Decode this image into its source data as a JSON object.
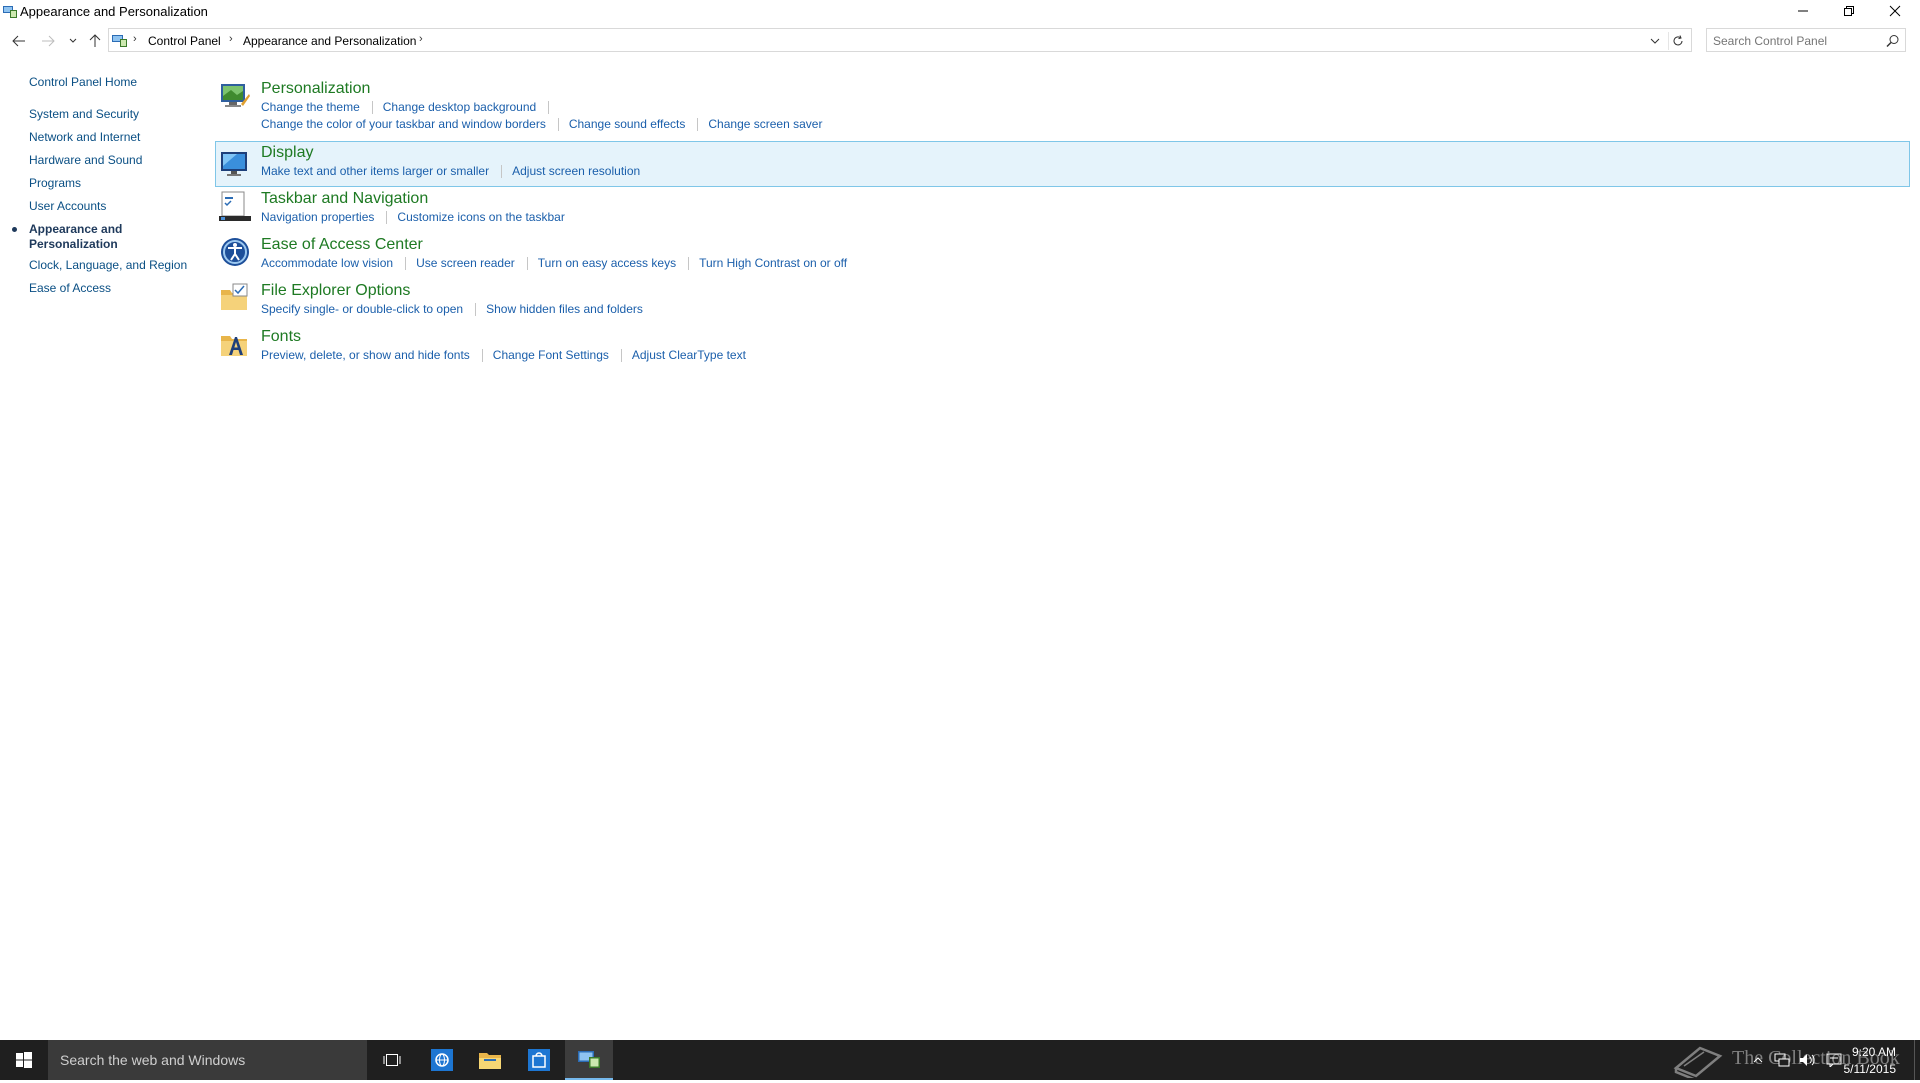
{
  "window": {
    "title": "Appearance and Personalization",
    "controls": [
      "minimize-icon",
      "restore-icon",
      "close-icon"
    ]
  },
  "address_bar": {
    "breadcrumbs": [
      "Control Panel",
      "Appearance and Personalization"
    ],
    "search_placeholder": "Search Control Panel"
  },
  "left_nav": {
    "home": "Control Panel Home",
    "items": [
      {
        "label": "System and Security"
      },
      {
        "label": "Network and Internet"
      },
      {
        "label": "Hardware and Sound"
      },
      {
        "label": "Programs"
      },
      {
        "label": "User Accounts"
      },
      {
        "label": "Appearance and",
        "label2": "Personalization",
        "active": true
      },
      {
        "label": "Clock, Language, and Region"
      },
      {
        "label": "Ease of Access"
      }
    ]
  },
  "categories": [
    {
      "title": "Personalization",
      "icon": "personalization-icon",
      "links_row1": [
        "Change the theme",
        "Change desktop background"
      ],
      "links_row2": [
        "Change the color of your taskbar and window borders",
        "Change sound effects",
        "Change screen saver"
      ]
    },
    {
      "title": "Display",
      "icon": "display-icon",
      "highlighted": true,
      "links_row1": [
        "Make text and other items larger or smaller",
        "Adjust screen resolution"
      ]
    },
    {
      "title": "Taskbar and Navigation",
      "icon": "taskbar-icon",
      "links_row1": [
        "Navigation properties",
        "Customize icons on the taskbar"
      ]
    },
    {
      "title": "Ease of Access Center",
      "icon": "ease-of-access-icon",
      "links_row1": [
        "Accommodate low vision",
        "Use screen reader",
        "Turn on easy access keys",
        "Turn High Contrast on or off"
      ]
    },
    {
      "title": "File Explorer Options",
      "icon": "folder-options-icon",
      "links_row1": [
        "Specify single- or double-click to open",
        "Show hidden files and folders"
      ]
    },
    {
      "title": "Fonts",
      "icon": "fonts-icon",
      "links_row1": [
        "Preview, delete, or show and hide fonts",
        "Change Font Settings",
        "Adjust ClearType text"
      ]
    }
  ],
  "taskbar": {
    "search_text": "Search the web and Windows",
    "clock_time": "9:20 AM",
    "clock_date": "5/11/2015",
    "watermark": "The Collection Book"
  },
  "colors": {
    "category_title": "#1e7a23",
    "link": "#1b5fab",
    "highlight_bg": "#e5f3fb",
    "highlight_border": "#7fc6e8",
    "taskbar": "#1f1f1f"
  }
}
